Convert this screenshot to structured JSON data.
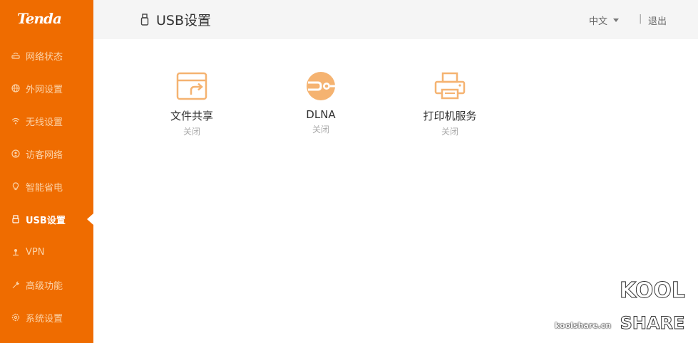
{
  "brand": {
    "logo_text": "Tenda",
    "accent": "#ef6c00",
    "icon_color": "#f5b371"
  },
  "sidebar": {
    "items": [
      {
        "label": "网络状态",
        "icon": "router-icon",
        "active": false
      },
      {
        "label": "外网设置",
        "icon": "globe-icon",
        "active": false
      },
      {
        "label": "无线设置",
        "icon": "wifi-icon",
        "active": false
      },
      {
        "label": "访客网络",
        "icon": "guest-icon",
        "active": false
      },
      {
        "label": "智能省电",
        "icon": "bulb-icon",
        "active": false
      },
      {
        "label": "USB设置",
        "icon": "usb-icon",
        "active": true
      },
      {
        "label": "VPN",
        "icon": "vpn-icon",
        "active": false
      },
      {
        "label": "高级功能",
        "icon": "wrench-icon",
        "active": false
      },
      {
        "label": "系统设置",
        "icon": "gear-icon",
        "active": false
      }
    ]
  },
  "header": {
    "title": "USB设置",
    "title_icon": "usb-icon",
    "language": "中文",
    "separator": "|",
    "logout": "退出"
  },
  "tiles": [
    {
      "label": "文件共享",
      "status": "关闭",
      "icon": "folder-share-icon"
    },
    {
      "label": "DLNA",
      "status": "关闭",
      "icon": "dlna-icon"
    },
    {
      "label": "打印机服务",
      "status": "关闭",
      "icon": "printer-icon"
    }
  ],
  "watermark": {
    "site": "koolshare.cn",
    "logo_top": "KOOL",
    "logo_bottom": "SHARE"
  }
}
